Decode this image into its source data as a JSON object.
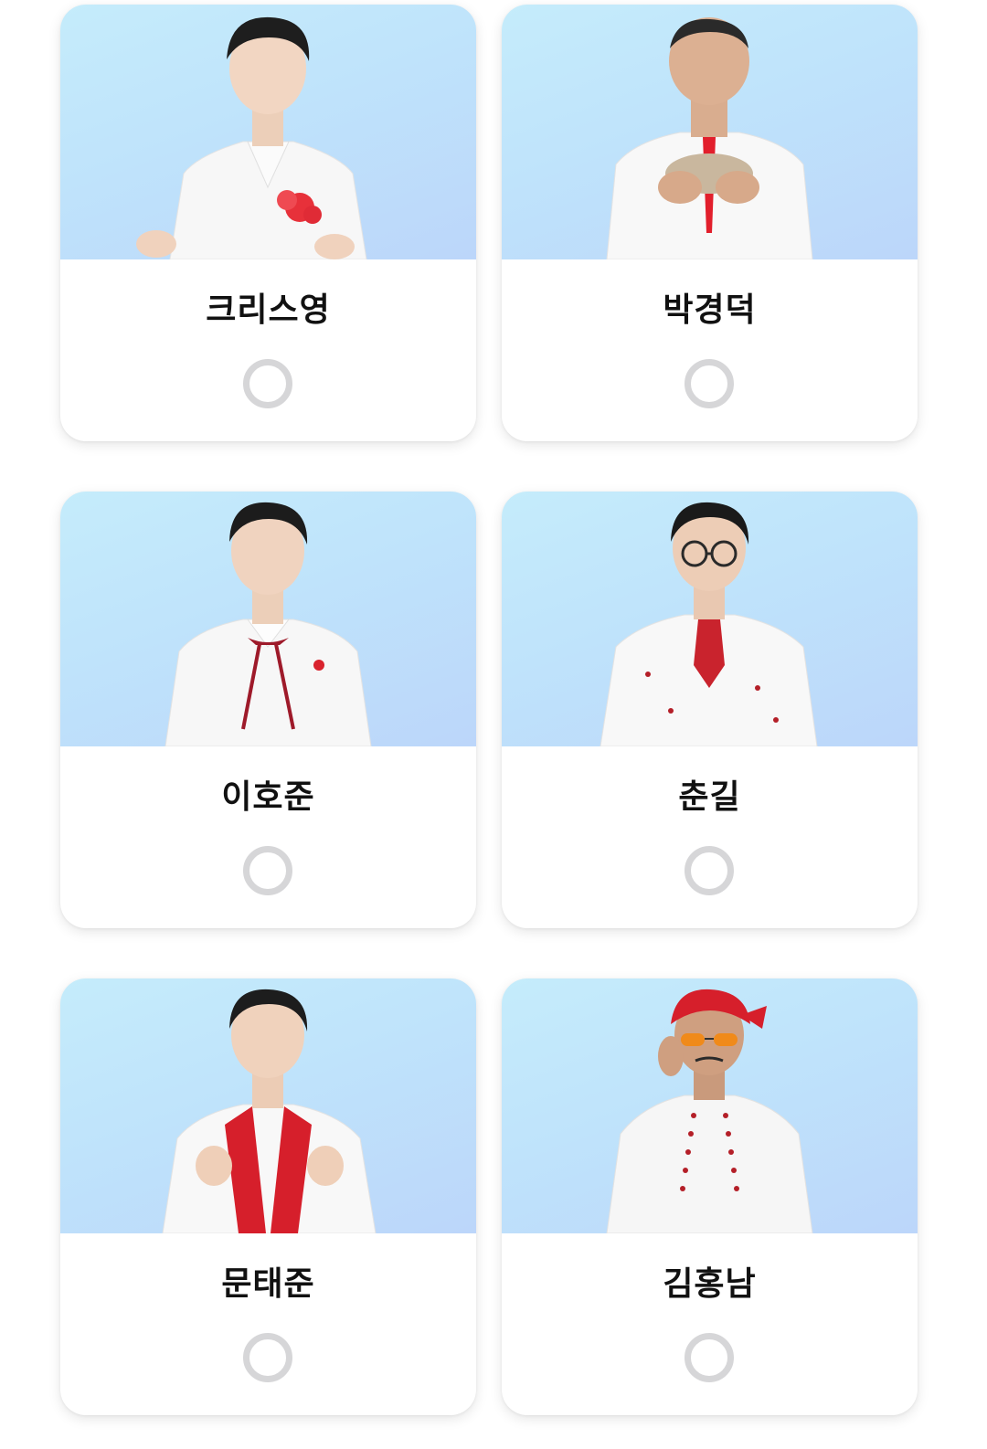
{
  "candidates": [
    {
      "name": "크리스영",
      "selected": false,
      "photo_icon": "singer-portrait-white-suit-red-corsage"
    },
    {
      "name": "박경덕",
      "selected": false,
      "photo_icon": "singer-portrait-white-suit-red-tie"
    },
    {
      "name": "이호준",
      "selected": false,
      "photo_icon": "singer-portrait-white-suit-red-ribbon"
    },
    {
      "name": "춘길",
      "selected": false,
      "photo_icon": "singer-portrait-glasses-red-jabot"
    },
    {
      "name": "문태준",
      "selected": false,
      "photo_icon": "singer-portrait-white-red-lapel-jacket"
    },
    {
      "name": "김홍남",
      "selected": false,
      "photo_icon": "singer-portrait-red-bandana-sunglasses"
    }
  ],
  "colors": {
    "photo_bg_top": "#c5ecfb",
    "photo_bg_bottom": "#bcd6fa",
    "radio_border": "#d6d6d8",
    "accent_red": "#d9232e"
  }
}
